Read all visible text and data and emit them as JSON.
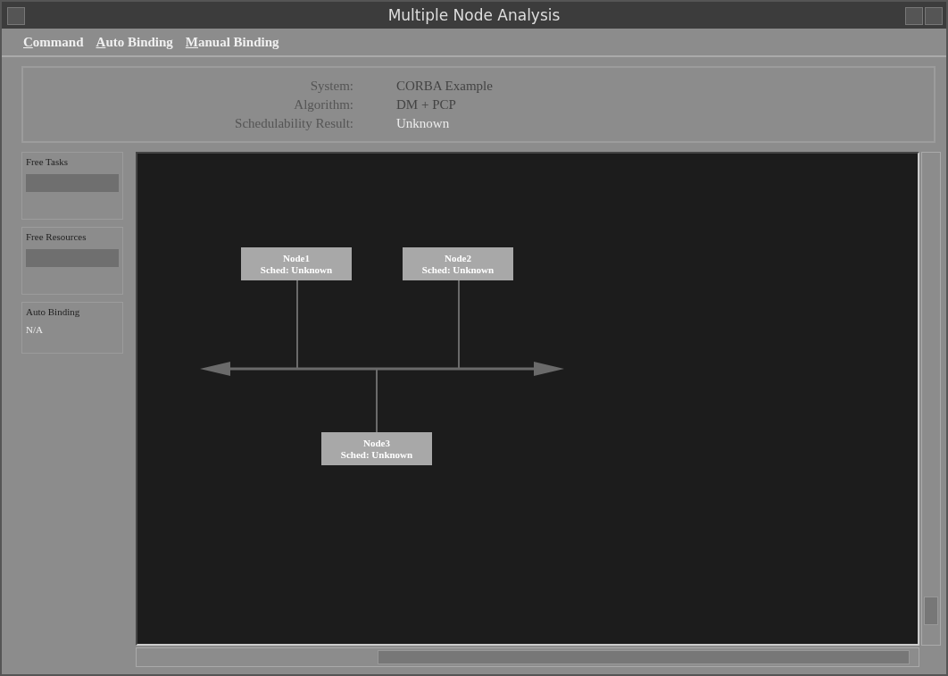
{
  "window": {
    "title": "Multiple Node Analysis"
  },
  "menu": [
    {
      "label": "Command"
    },
    {
      "label": "Auto Binding"
    },
    {
      "label": "Manual Binding"
    }
  ],
  "info": [
    {
      "label": "System:",
      "value": "CORBA Example",
      "dim": false
    },
    {
      "label": "Algorithm:",
      "value": "DM + PCP",
      "dim": false
    },
    {
      "label": "Schedulability Result:",
      "value": "Unknown",
      "dim": true
    }
  ],
  "side_panels": [
    {
      "kind": "list",
      "title": "Free Tasks"
    },
    {
      "kind": "list",
      "title": "Free Resources"
    },
    {
      "kind": "text",
      "title": "Auto Binding",
      "value": "N/A"
    }
  ],
  "nodes": [
    {
      "name": "Node1",
      "status": "Sched: Unknown"
    },
    {
      "name": "Node2",
      "status": "Sched: Unknown"
    },
    {
      "name": "Node3",
      "status": "Sched: Unknown"
    }
  ]
}
